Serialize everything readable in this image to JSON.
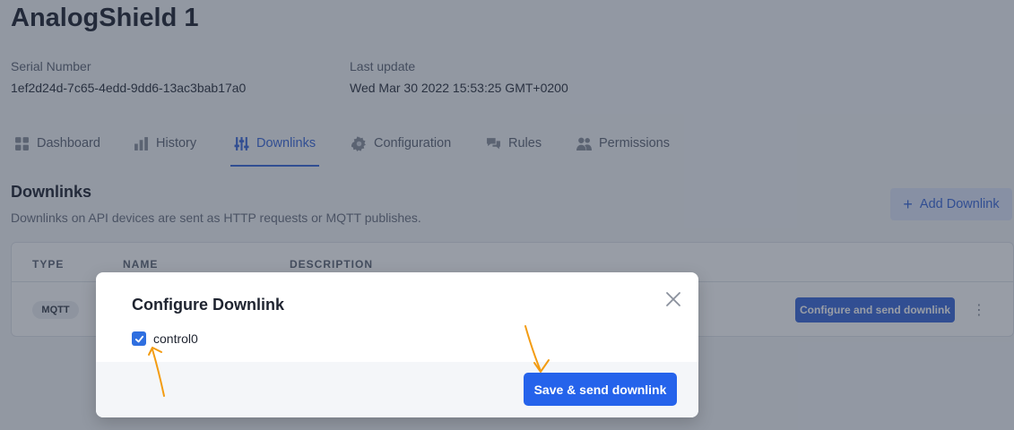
{
  "device": {
    "title": "AnalogShield 1",
    "serial_label": "Serial Number",
    "serial_value": "1ef2d24d-7c65-4edd-9dd6-13ac3bab17a0",
    "update_label": "Last update",
    "update_value": "Wed Mar 30 2022 15:53:25 GMT+0200"
  },
  "tabs": [
    {
      "label": "Dashboard",
      "icon": "dashboard-icon"
    },
    {
      "label": "History",
      "icon": "bar-chart-icon"
    },
    {
      "label": "Downlinks",
      "icon": "sliders-icon",
      "active": true
    },
    {
      "label": "Configuration",
      "icon": "gear-icon"
    },
    {
      "label": "Rules",
      "icon": "chat-icon"
    },
    {
      "label": "Permissions",
      "icon": "users-icon"
    }
  ],
  "downlinks": {
    "title": "Downlinks",
    "description": "Downlinks on API devices are sent as HTTP requests or MQTT publishes.",
    "add_button": "Add Downlink",
    "columns": [
      "TYPE",
      "NAME",
      "DESCRIPTION"
    ],
    "rows": [
      {
        "type": "MQTT",
        "action": "Configure and send downlink"
      }
    ]
  },
  "modal": {
    "title": "Configure Downlink",
    "checkbox_label": "control0",
    "checkbox_checked": true,
    "save_button": "Save & send downlink"
  },
  "colors": {
    "accent": "#3b68d9",
    "primary_button": "#2563eb",
    "annotation": "#f39c12"
  }
}
